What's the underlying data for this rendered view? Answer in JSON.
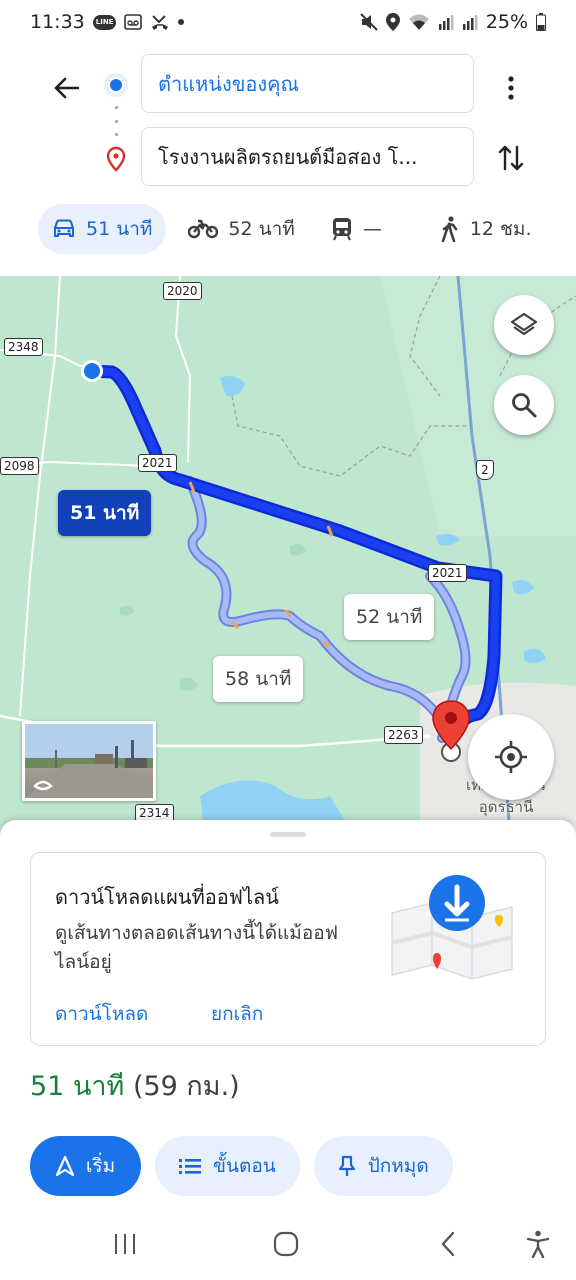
{
  "status_bar": {
    "time": "11:33",
    "line_badge": "LINE",
    "battery": "25%"
  },
  "search": {
    "origin": "ตำแหน่งของคุณ",
    "destination": "โรงงานผลิตรถยนต์มือสอง โ..."
  },
  "modes": [
    {
      "icon": "car-icon",
      "label": "51 นาที",
      "active": true
    },
    {
      "icon": "motorcycle-icon",
      "label": "52 นาที",
      "active": false
    },
    {
      "icon": "transit-icon",
      "label": "—",
      "active": false
    },
    {
      "icon": "walk-icon",
      "label": "12 ชม.",
      "active": false
    }
  ],
  "map": {
    "road_labels": [
      "2020",
      "2348",
      "2098",
      "2021",
      "2021",
      "2263",
      "2314"
    ],
    "highway_shield": "2",
    "route_tags": {
      "primary": "51 นาที",
      "alt1": "52 นาที",
      "alt2": "58 นาที"
    },
    "city_label_line1": "เทศบาลนคร",
    "city_label_line2": "อุดรธานี"
  },
  "offline_card": {
    "title": "ดาวน์โหลดแผนที่ออฟไลน์",
    "description": "ดูเส้นทางตลอดเส้นทางนี้ได้แม้ออฟไลน์อยู่",
    "download_label": "ดาวน์โหลด",
    "cancel_label": "ยกเลิก"
  },
  "summary": {
    "time": "51 นาที",
    "distance": "(59 กม.)"
  },
  "actions": {
    "start": "เริ่ม",
    "steps": "ขั้นตอน",
    "pin": "ปักหมุด"
  },
  "colors": {
    "accent": "#1a73e8",
    "route": "#1a3ff0",
    "alt_route": "#8fa6f3",
    "map_green": "#bfe6cf",
    "water": "#8fd3f4",
    "summary_green": "#188038"
  }
}
